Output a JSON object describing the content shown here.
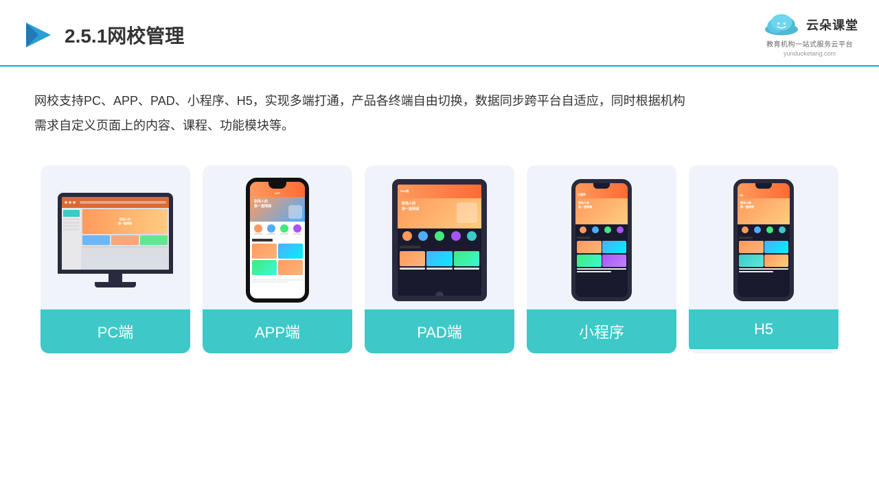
{
  "header": {
    "title": "2.5.1网校管理",
    "logo_name": "云朵课堂",
    "logo_url": "yunduoketang.com",
    "logo_tagline": "教育机构一站\n式服务云平台"
  },
  "description": {
    "text": "网校支持PC、APP、PAD、小程序、H5，实现多端打通，产品各终端自由切换，数据同步跨平台自适应，同时根据机构需求自定义页面上的内容、课程、功能模块等。"
  },
  "cards": [
    {
      "id": "pc",
      "label": "PC端"
    },
    {
      "id": "app",
      "label": "APP端"
    },
    {
      "id": "pad",
      "label": "PAD端"
    },
    {
      "id": "miniprogram",
      "label": "小程序"
    },
    {
      "id": "h5",
      "label": "H5"
    }
  ],
  "colors": {
    "accent": "#3ec8c8",
    "header_line": "#00b8c8",
    "text_dark": "#333333",
    "card_bg": "#f0f4fa"
  }
}
